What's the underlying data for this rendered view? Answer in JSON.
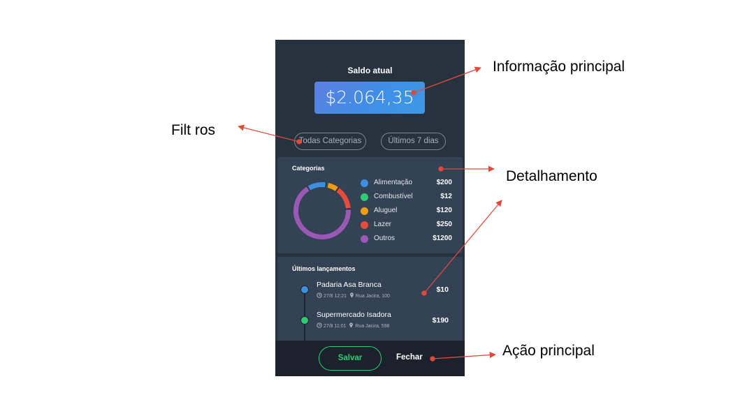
{
  "phone": {
    "balance_label": "Saldo atual",
    "balance_value": "$2.064,35",
    "filters": {
      "category": "Todas Categorias",
      "period": "Últimos 7 dias"
    },
    "categories_card": {
      "title": "Categorias",
      "items": [
        {
          "label": "Alimentação",
          "value": "$200",
          "color": "#3d8fe0"
        },
        {
          "label": "Combustível",
          "value": "$12",
          "color": "#2ecc71"
        },
        {
          "label": "Aluguel",
          "value": "$120",
          "color": "#f39c12"
        },
        {
          "label": "Lazer",
          "value": "$250",
          "color": "#e74c3c"
        },
        {
          "label": "Outros",
          "value": "$1200",
          "color": "#9b59b6"
        }
      ]
    },
    "transactions_card": {
      "title": "Últimos lançamentos",
      "items": [
        {
          "name": "Padaria Asa Branca",
          "time": "27/8 12:21",
          "location": "Rua Jacira, 100",
          "amount": "$10",
          "color": "#3d8fe0"
        },
        {
          "name": "Supermercado Isadora",
          "time": "27/8 11:01",
          "location": "Rua Jacira, 598",
          "amount": "$190",
          "color": "#2ecc71"
        }
      ]
    },
    "actions": {
      "save_label": "Salvar",
      "close_label": "Fechar"
    }
  },
  "annotations": {
    "main_info": "Informação principal",
    "filters": "Filt ros",
    "detail": "Detalhamento",
    "main_action": "Ação principal"
  },
  "colors": {
    "annotation_arrow": "#e04a3a",
    "phone_bg": "#27323f",
    "card_bg": "#344255",
    "accent_green": "#2ecc71"
  }
}
